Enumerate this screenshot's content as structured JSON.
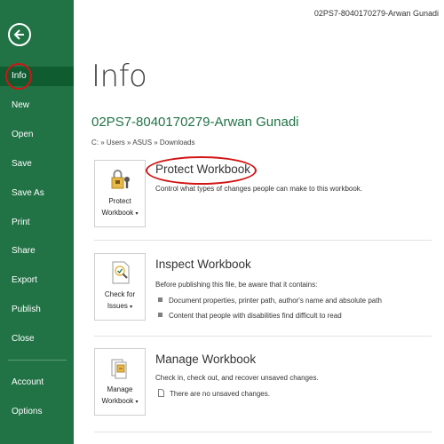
{
  "window": {
    "title": "02PS7-8040170279-Arwan Gunadi"
  },
  "sidebar": {
    "back_icon": "back-arrow-icon",
    "items": [
      {
        "label": "Info"
      },
      {
        "label": "New"
      },
      {
        "label": "Open"
      },
      {
        "label": "Save"
      },
      {
        "label": "Save As"
      },
      {
        "label": "Print"
      },
      {
        "label": "Share"
      },
      {
        "label": "Export"
      },
      {
        "label": "Publish"
      },
      {
        "label": "Close"
      },
      {
        "label": "Account"
      },
      {
        "label": "Options"
      }
    ],
    "active": "Info",
    "colors": {
      "background": "#217346",
      "active": "#0f5c31"
    }
  },
  "main": {
    "title": "Info",
    "file_name": "02PS7-8040170279-Arwan Gunadi",
    "path": "C: » Users » ASUS » Downloads",
    "sections": [
      {
        "button_label_1": "Protect",
        "button_label_2": "Workbook",
        "icon": "lock-key-icon",
        "title": "Protect Workbook",
        "description": "Control what types of changes people can make to this workbook."
      },
      {
        "button_label_1": "Check for",
        "button_label_2": "Issues",
        "icon": "inspect-document-icon",
        "title": "Inspect Workbook",
        "description": "Before publishing this file, be aware that it contains:",
        "bullets": [
          "Document properties, printer path, author's name and absolute path",
          "Content that people with disabilities find difficult to read"
        ]
      },
      {
        "button_label_1": "Manage",
        "button_label_2": "Workbook",
        "icon": "manage-workbook-icon",
        "title": "Manage Workbook",
        "description": "Check in, check out, and recover unsaved changes.",
        "note": "There are no unsaved changes."
      }
    ]
  },
  "annotation_color": "#d21414"
}
